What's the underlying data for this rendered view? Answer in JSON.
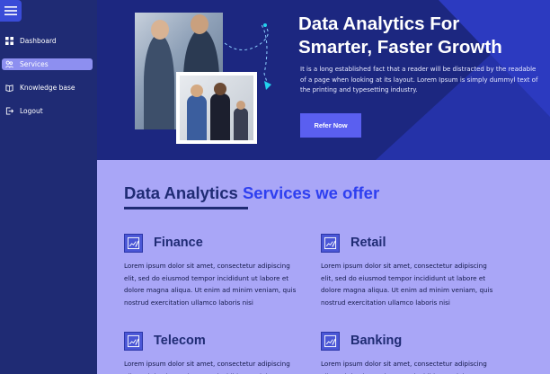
{
  "sidebar": {
    "items": [
      {
        "label": "Dashboard",
        "icon": "grid-icon",
        "active": false
      },
      {
        "label": "Services",
        "icon": "people-icon",
        "active": true
      },
      {
        "label": "Knowledge base",
        "icon": "book-icon",
        "active": false
      },
      {
        "label": "Logout",
        "icon": "logout-icon",
        "active": false
      }
    ]
  },
  "hero": {
    "title_line1": "Data Analytics For",
    "title_line2": "Smarter, Faster Growth",
    "text": "It is a long established fact that a reader will be distracted by the readable of a page when looking at its layout. Lorem Ipsum is simply dummyl text of the printing and typesetting industry.",
    "cta_label": "Refer Now"
  },
  "services": {
    "title_part1": "Data Analytics",
    "title_part2": "Services we offer",
    "cards": [
      {
        "name": "Finance",
        "icon": "chart-pen-icon",
        "desc": "Lorem ipsum dolor sit amet, consectetur adipiscing elit, sed do eiusmod tempor incididunt ut labore et dolore magna aliqua. Ut enim ad minim veniam, quis nostrud exercitation ullamco laboris nisi"
      },
      {
        "name": "Retail",
        "icon": "chart-pen-icon",
        "desc": "Lorem ipsum dolor sit amet, consectetur adipiscing elit, sed do eiusmod tempor incididunt ut labore et dolore magna aliqua. Ut enim ad minim veniam, quis nostrud exercitation ullamco laboris nisi"
      },
      {
        "name": "Telecom",
        "icon": "chart-pen-icon",
        "desc": "Lorem ipsum dolor sit amet, consectetur adipiscing elit, sed do eiusmod tempor incididunt ut labore et"
      },
      {
        "name": "Banking",
        "icon": "chart-pen-icon",
        "desc": "Lorem ipsum dolor sit amet, consectetur adipiscing elit, sed do eiusmod tempor incididunt ut labore et"
      }
    ]
  },
  "colors": {
    "sidebar_bg": "#1f2b74",
    "active_item": "#8d8ff0",
    "cta": "#5a5ff0",
    "services_bg": "#a9a6f7",
    "accent_blue": "#2e3ff0"
  }
}
